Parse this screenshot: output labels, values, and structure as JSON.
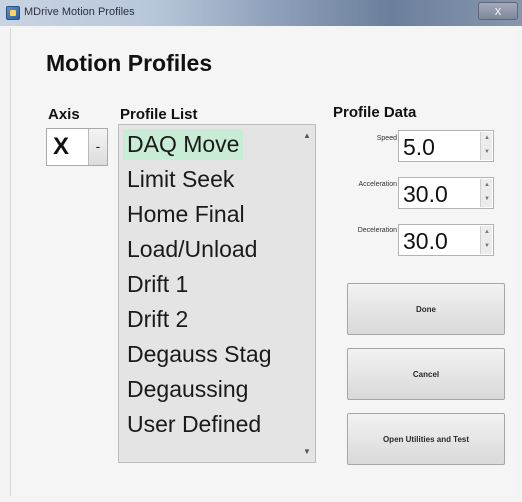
{
  "window": {
    "title": "MDrive Motion Profiles",
    "close_glyph": "x"
  },
  "heading": "Motion Profiles",
  "axis": {
    "label": "Axis",
    "selected": "X",
    "dropdown_glyph": "-"
  },
  "profile_list": {
    "label": "Profile List",
    "items": [
      {
        "label": "DAQ Move",
        "selected": true
      },
      {
        "label": "Limit Seek",
        "selected": false
      },
      {
        "label": "Home Final",
        "selected": false
      },
      {
        "label": "Load/Unload",
        "selected": false
      },
      {
        "label": "Drift 1",
        "selected": false
      },
      {
        "label": "Drift 2",
        "selected": false
      },
      {
        "label": "Degauss Stag",
        "selected": false
      },
      {
        "label": "Degaussing",
        "selected": false
      },
      {
        "label": "User Defined",
        "selected": false
      }
    ]
  },
  "profile_data": {
    "label": "Profile Data",
    "speed": {
      "label": "Speed",
      "value": "5.0"
    },
    "acceleration": {
      "label": "Acceleration",
      "value": "30.0"
    },
    "deceleration": {
      "label": "Deceleration",
      "value": "30.0"
    }
  },
  "buttons": {
    "done": "Done",
    "cancel": "Cancel",
    "utilities": "Open Utilities and Test"
  },
  "colors": {
    "selection": "#c9ecd6"
  }
}
